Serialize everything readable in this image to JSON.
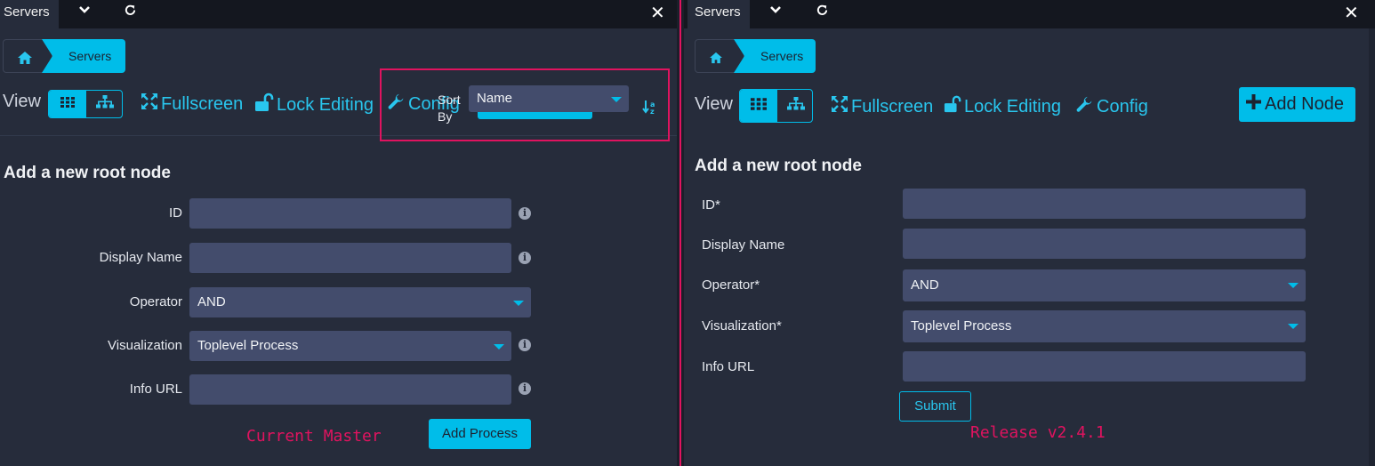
{
  "left": {
    "tab_label": "Servers",
    "breadcrumb": {
      "current": "Servers"
    },
    "toolbar": {
      "view_label": "View",
      "fullscreen_label": "Fullscreen",
      "lock_editing_label": "Lock Editing",
      "config_label": "Config",
      "sort_by_label_line1": "Sort",
      "sort_by_label_line2": "By",
      "sort_value": "Name"
    },
    "form": {
      "title": "Add a new root node",
      "id_label": "ID",
      "display_name_label": "Display Name",
      "operator_label": "Operator",
      "operator_value": "AND",
      "visualization_label": "Visualization",
      "visualization_value": "Toplevel Process",
      "info_url_label": "Info URL",
      "submit_label": "Add Process"
    },
    "annotation": "Current Master"
  },
  "right": {
    "tab_label": "Servers",
    "breadcrumb": {
      "current": "Servers"
    },
    "toolbar": {
      "view_label": "View",
      "fullscreen_label": "Fullscreen",
      "lock_editing_label": "Lock Editing",
      "config_label": "Config",
      "add_node_label": "Add Node"
    },
    "form": {
      "title": "Add a new root node",
      "id_label": "ID*",
      "display_name_label": "Display Name",
      "operator_label": "Operator*",
      "operator_value": "AND",
      "visualization_label": "Visualization*",
      "visualization_value": "Toplevel Process",
      "info_url_label": "Info URL",
      "submit_label": "Submit"
    },
    "annotation": "Release v2.4.1"
  },
  "colors": {
    "accent": "#00bde9",
    "highlight": "#e0135f",
    "panel_bg": "#262c3b",
    "input_bg": "#434c6c"
  }
}
